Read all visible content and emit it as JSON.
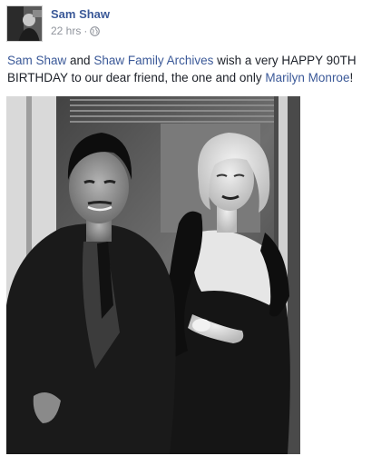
{
  "post": {
    "author": "Sam Shaw",
    "time": "22 hrs",
    "separator": "·",
    "privacy_icon": "globe-icon",
    "text": {
      "link1": "Sam Shaw",
      "t1": " and ",
      "link2": "Shaw Family Archives",
      "t2": " wish a very HAPPY 90TH BIRTHDAY to our dear friend, the one and only ",
      "link3": "Marilyn Monroe",
      "t3": "!"
    }
  },
  "colors": {
    "link": "#3b5998",
    "meta": "#90949c",
    "text": "#1d2129"
  }
}
